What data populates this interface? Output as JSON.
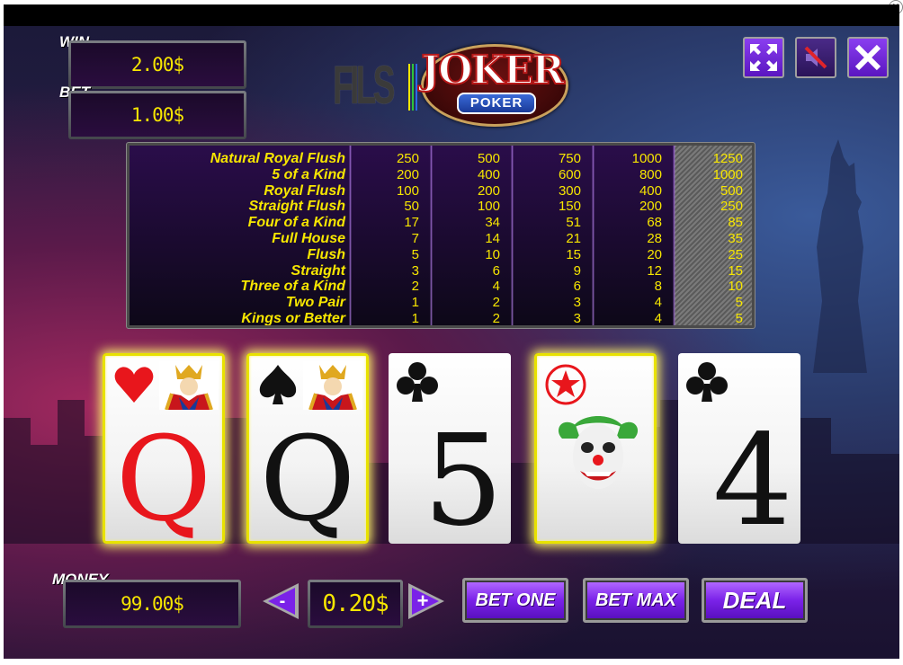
{
  "win": {
    "label": "WIN",
    "value": "2.00$"
  },
  "bet": {
    "label": "BET",
    "value": "1.00$"
  },
  "money": {
    "label": "MONEY",
    "value": "99.00$"
  },
  "logo": {
    "brand": "FILS",
    "title": "JOKER",
    "subtitle": "POKER"
  },
  "top_buttons": [
    {
      "name": "fullscreen-icon"
    },
    {
      "name": "sound-muted-icon"
    },
    {
      "name": "close-icon"
    }
  ],
  "close_corner": "×",
  "paytable": {
    "rows": [
      {
        "hand": "Natural Royal Flush",
        "payouts": [
          "250",
          "500",
          "750",
          "1000",
          "1250"
        ]
      },
      {
        "hand": "5 of a Kind",
        "payouts": [
          "200",
          "400",
          "600",
          "800",
          "1000"
        ]
      },
      {
        "hand": "Royal Flush",
        "payouts": [
          "100",
          "200",
          "300",
          "400",
          "500"
        ]
      },
      {
        "hand": "Straight Flush",
        "payouts": [
          "50",
          "100",
          "150",
          "200",
          "250"
        ]
      },
      {
        "hand": "Four of a Kind",
        "payouts": [
          "17",
          "34",
          "51",
          "68",
          "85"
        ]
      },
      {
        "hand": "Full House",
        "payouts": [
          "7",
          "14",
          "21",
          "28",
          "35"
        ]
      },
      {
        "hand": "Flush",
        "payouts": [
          "5",
          "10",
          "15",
          "20",
          "25"
        ]
      },
      {
        "hand": "Straight",
        "payouts": [
          "3",
          "6",
          "9",
          "12",
          "15"
        ]
      },
      {
        "hand": "Three of a Kind",
        "payouts": [
          "2",
          "4",
          "6",
          "8",
          "10"
        ]
      },
      {
        "hand": "Two Pair",
        "payouts": [
          "1",
          "2",
          "3",
          "4",
          "5"
        ]
      },
      {
        "hand": "Kings or Better",
        "payouts": [
          "1",
          "2",
          "3",
          "4",
          "5"
        ]
      }
    ],
    "highlighted_column": 5
  },
  "cards": [
    {
      "rank": "Q",
      "suit": "hearts",
      "color": "#e8161c",
      "held": true
    },
    {
      "rank": "Q",
      "suit": "spades",
      "color": "#111111",
      "held": true
    },
    {
      "rank": "5",
      "suit": "clubs",
      "color": "#111111",
      "held": false
    },
    {
      "rank": "",
      "suit": "joker",
      "color": "#e8161c",
      "held": true
    },
    {
      "rank": "4",
      "suit": "clubs",
      "color": "#111111",
      "held": false
    }
  ],
  "coin": {
    "value": "0.20$",
    "decrease": "-",
    "increase": "+"
  },
  "buttons": {
    "bet_one": "BET ONE",
    "bet_max": "BET MAX",
    "deal": "DEAL"
  },
  "colors": {
    "accent": "#f7e600",
    "button": "#7a22e8",
    "held_border": "#e8e200"
  }
}
